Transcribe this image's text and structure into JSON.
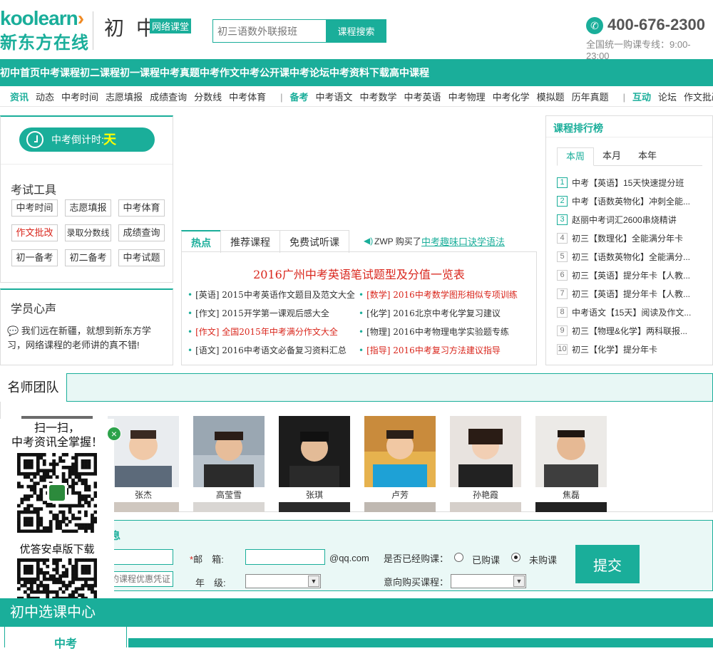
{
  "header": {
    "logo_en_main": "koolearn",
    "logo_cn": "新东方在线",
    "grade": "初 中",
    "grade_tag": "网络课堂",
    "search_placeholder": "初三语数外联报班",
    "search_button": "课程搜索",
    "phone": "400-676-2300",
    "phone_sub": "全国统一购课专线：9:00-23:00"
  },
  "nav": [
    "初中首页",
    "中考课程",
    "初二课程",
    "初一课程",
    "中考真题",
    "中考作文",
    "中考公开课",
    "中考论坛",
    "中考资料下载",
    "高中课程"
  ],
  "subnav": {
    "g1_head": "资讯",
    "g1": [
      "动态",
      "中考时间",
      "志愿填报",
      "成绩查询",
      "分数线",
      "中考体育"
    ],
    "g2_head": "备考",
    "g2": [
      "中考语文",
      "中考数学",
      "中考英语",
      "中考物理",
      "中考化学",
      "模拟题",
      "历年真题"
    ],
    "g3_head": "互动",
    "g3": [
      "论坛",
      "作文批改"
    ],
    "sep": "|"
  },
  "countdown": {
    "label": "中考倒计时:",
    "day": "天"
  },
  "tools": {
    "title": "考试工具",
    "items": [
      "中考时间",
      "志愿填报",
      "中考体育",
      "作文批改",
      "录取分数线",
      "成绩查询",
      "初一备考",
      "初二备考",
      "中考试题"
    ]
  },
  "voice": {
    "title": "学员心声",
    "text": "我们远在新疆，就想到新东方学习，网络课程的老师讲的真不错!"
  },
  "tabs": [
    "热点",
    "推荐课程",
    "免费试听课"
  ],
  "ticker": {
    "user": "ZWP",
    "action": "购买了",
    "course": "中考趣味口诀学语法"
  },
  "headline": "2016广州中考英语笔试题型及分值一览表",
  "news": [
    {
      "tag": "[英语]",
      "title": "2015中考英语作文题目及范文大全",
      "red": false
    },
    {
      "tag": "[数学]",
      "title": "2016中考数学图形相似专项训练",
      "red": true
    },
    {
      "tag": "[作文]",
      "title": "2015开学第一课观后感大全",
      "red": false
    },
    {
      "tag": "[化学]",
      "title": "2016北京中考化学复习建议",
      "red": false
    },
    {
      "tag": "[作文]",
      "title": "全国2015年中考满分作文大全",
      "red": true
    },
    {
      "tag": "[物理]",
      "title": "2016中考物理电学实验题专练",
      "red": false
    },
    {
      "tag": "[语文]",
      "title": "2016中考语文必备复习资料汇总",
      "red": false
    },
    {
      "tag": "[指导]",
      "title": "2016中考复习方法建议指导",
      "red": true
    }
  ],
  "rank": {
    "title": "课程排行榜",
    "tabs": [
      "本周",
      "本月",
      "本年"
    ],
    "items": [
      "中考【英语】15天快速提分班",
      "中考【语数英物化】冲刺全能...",
      "赵丽中考词汇2600串烧精讲",
      "初三【数理化】全能满分年卡",
      "初三【语数英物化】全能满分...",
      "初三【英语】提分年卡【人教...",
      "初三【英语】提分年卡【人教...",
      "中考语文【15天】阅读及作文...",
      "初三【物理&化学】两科联报...",
      "初三【化学】提分年卡"
    ]
  },
  "teachers": {
    "title": "名师团队",
    "names": [
      "张杰",
      "高莹雪",
      "张琪",
      "卢芳",
      "孙艳霞",
      "焦磊"
    ]
  },
  "form": {
    "title": "息",
    "coupon_placeholder": "的课程优惠凭证",
    "email_label": "邮　箱:",
    "email_suffix": "@qq.com",
    "grade_label": "年　级:",
    "bought_label": "是否已经购课：",
    "opt_yes": "已购课",
    "opt_no": "未购课",
    "intent_label": "意向购买课程：",
    "req_mark": "*",
    "submit": "提交"
  },
  "course_center": {
    "title": "初中选课中心",
    "left_label": "中考"
  },
  "qr": {
    "line1": "扫一扫，",
    "line2": "中考资讯全掌握！",
    "app_text": "优答安卓版下载",
    "close": "×"
  },
  "colors": {
    "brand": "#1aae9a",
    "accent_orange": "#f08a24",
    "hot_red": "#d9261c"
  }
}
